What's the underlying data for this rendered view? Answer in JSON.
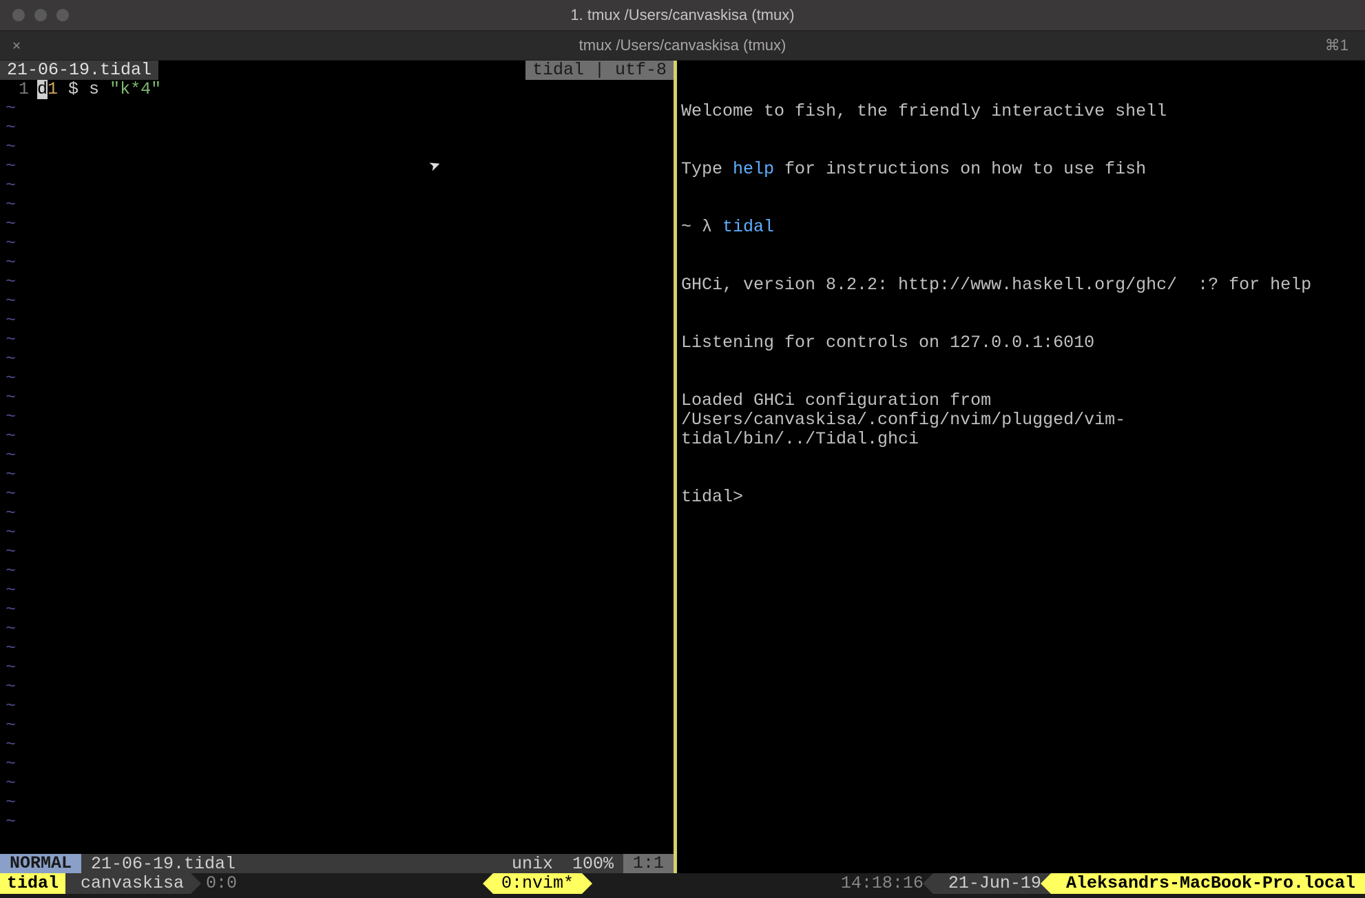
{
  "titlebar": {
    "title": "1. tmux /Users/canvaskisa (tmux)"
  },
  "tabbar": {
    "title": "tmux /Users/canvaskisa (tmux)",
    "shortcut": "⌘1"
  },
  "vim": {
    "filename_tab": "21-06-19.tidal",
    "right_tab": "tidal | utf-8",
    "line_number": "1",
    "code": {
      "cursor_char": "d",
      "after_cursor_ident": "1",
      "dollar": " $ ",
      "func": "s",
      "string": " \"k*4\""
    },
    "status": {
      "mode": "NORMAL",
      "filename": "21-06-19.tidal",
      "fileformat": "unix",
      "percent": "100%",
      "position": "1:1"
    }
  },
  "repl": {
    "line1": "Welcome to fish, the friendly interactive shell",
    "line2_pre": "Type ",
    "line2_help": "help",
    "line2_post": " for instructions on how to use fish",
    "line3_prompt": "~ λ ",
    "line3_cmd": "tidal",
    "line4": "GHCi, version 8.2.2: http://www.haskell.org/ghc/  :? for help",
    "line5": "Listening for controls on 127.0.0.1:6010",
    "line6": "Loaded GHCi configuration from /Users/canvaskisa/.config/nvim/plugged/vim-tidal/bin/../Tidal.ghci",
    "line7": "tidal>"
  },
  "tmux": {
    "session": "tidal",
    "user": "canvaskisa",
    "pane_index": "0:0",
    "window": "0:nvim*",
    "time": "14:18:16",
    "date": "21-Jun-19",
    "host": "Aleksandrs-MacBook-Pro.local"
  }
}
